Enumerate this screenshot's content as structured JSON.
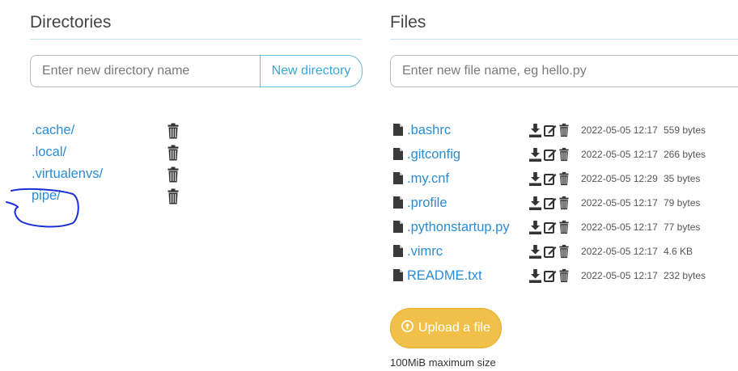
{
  "directories": {
    "heading": "Directories",
    "input_placeholder": "Enter new directory name",
    "new_button_label": "New directory",
    "items": [
      {
        "name": ".cache/"
      },
      {
        "name": ".local/"
      },
      {
        "name": ".virtualenvs/"
      },
      {
        "name": "pipe/"
      }
    ]
  },
  "files": {
    "heading": "Files",
    "input_placeholder": "Enter new file name, eg hello.py",
    "items": [
      {
        "name": ".bashrc",
        "modified": "2022-05-05 12:17",
        "size": "559 bytes"
      },
      {
        "name": ".gitconfig",
        "modified": "2022-05-05 12:17",
        "size": "266 bytes"
      },
      {
        "name": ".my.cnf",
        "modified": "2022-05-05 12:29",
        "size": "35 bytes"
      },
      {
        "name": ".profile",
        "modified": "2022-05-05 12:17",
        "size": "79 bytes"
      },
      {
        "name": ".pythonstartup.py",
        "modified": "2022-05-05 12:17",
        "size": "77 bytes"
      },
      {
        "name": ".vimrc",
        "modified": "2022-05-05 12:17",
        "size": "4.6 KB"
      },
      {
        "name": "README.txt",
        "modified": "2022-05-05 12:17",
        "size": "232 bytes"
      }
    ],
    "upload_label": "Upload a file",
    "max_size_note": "100MiB maximum size"
  },
  "colors": {
    "link": "#2a8cd3",
    "rule": "#bfe3ee",
    "upload_button": "#f0c04a",
    "annotation": "#1a2fd6"
  },
  "icons": {
    "directory_delete": "trash-icon",
    "file_type": "file-icon",
    "file_download": "download-icon",
    "file_edit": "edit-icon",
    "file_delete": "trash-icon",
    "upload": "upload-circle-icon"
  }
}
